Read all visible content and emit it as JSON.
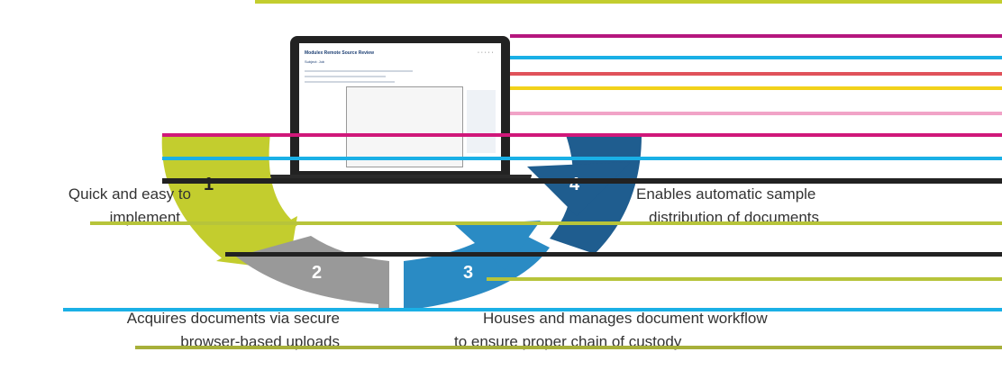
{
  "segments": [
    {
      "number": "1",
      "color": "#c3cd2e",
      "line1": "Quick and easy to",
      "line2": "implement"
    },
    {
      "number": "2",
      "color": "#999999",
      "line1": "Acquires documents via secure",
      "line2": "browser-based uploads"
    },
    {
      "number": "3",
      "color": "#2a8bc4",
      "line1": "Houses and manages document workflow",
      "line2": "to ensure proper chain of custody"
    },
    {
      "number": "4",
      "color": "#1f5d8f",
      "line1": "Enables automatic sample",
      "line2": "distribution of documents"
    }
  ],
  "screen": {
    "title": "Modulex Remote Source Review",
    "subtitle": "Subject: Job"
  }
}
